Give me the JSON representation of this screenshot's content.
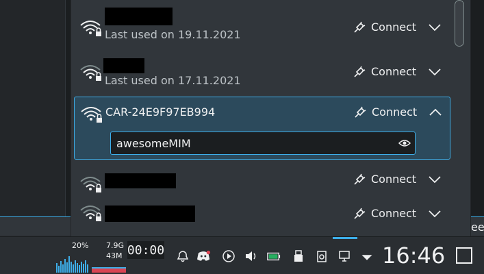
{
  "networks": [
    {
      "name": "",
      "redacted": true,
      "sub": "Last used on 19.11.2021",
      "action": "Connect",
      "expanded": false
    },
    {
      "name": "",
      "redacted": true,
      "sub": "Last used on 17.11.2021",
      "action": "Connect",
      "expanded": false
    },
    {
      "name": "CAR-24E9F97EB994",
      "redacted": false,
      "sub": "",
      "action": "Connect",
      "expanded": true,
      "password": "awesomeMIM"
    },
    {
      "name": "",
      "redacted": true,
      "sub": "",
      "action": "Connect",
      "expanded": false
    },
    {
      "name": "",
      "redacted": true,
      "sub": "",
      "action": "Connect",
      "expanded": false
    }
  ],
  "taskbar": {
    "cpu": "20%",
    "mem_total": "7.9G",
    "mem_used": "43M",
    "timer": "00:00",
    "clock": "16:46"
  },
  "background_text": "ee",
  "colors": {
    "accent": "#3daee9",
    "panel": "#31363b"
  }
}
